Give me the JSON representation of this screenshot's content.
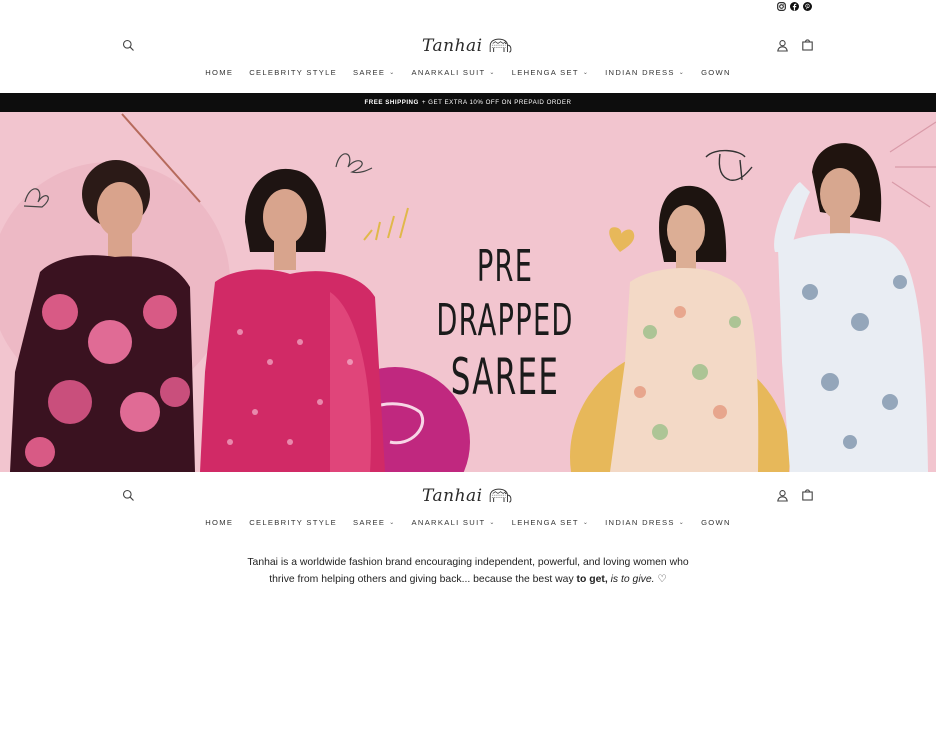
{
  "social": {
    "icons": [
      "instagram-icon",
      "facebook-icon",
      "pinterest-icon"
    ]
  },
  "header": {
    "logo_text": "Tanhai",
    "nav": [
      {
        "label": "HOME",
        "dropdown": false
      },
      {
        "label": "CELEBRITY STYLE",
        "dropdown": false
      },
      {
        "label": "SAREE",
        "dropdown": true
      },
      {
        "label": "ANARKALI SUIT",
        "dropdown": true
      },
      {
        "label": "LEHENGA SET",
        "dropdown": true
      },
      {
        "label": "INDIAN DRESS",
        "dropdown": true
      },
      {
        "label": "GOWN",
        "dropdown": false
      }
    ]
  },
  "announcement": {
    "bold": "FREE SHIPPING",
    "rest": "+ GET EXTRA 10% OFF ON PREPAID ORDER"
  },
  "hero": {
    "headline_line1": "PRE DRAPPED",
    "headline_line2": "SAREE",
    "background_color": "#f2c5cf"
  },
  "tagline": {
    "line1": "Tanhai is a worldwide fashion brand encouraging independent, powerful, and loving women who",
    "line2_start": "thrive from helping others and giving back... because the best way ",
    "line2_bold": "to get,",
    "line2_italic": "is to give.",
    "heart": "♡"
  }
}
